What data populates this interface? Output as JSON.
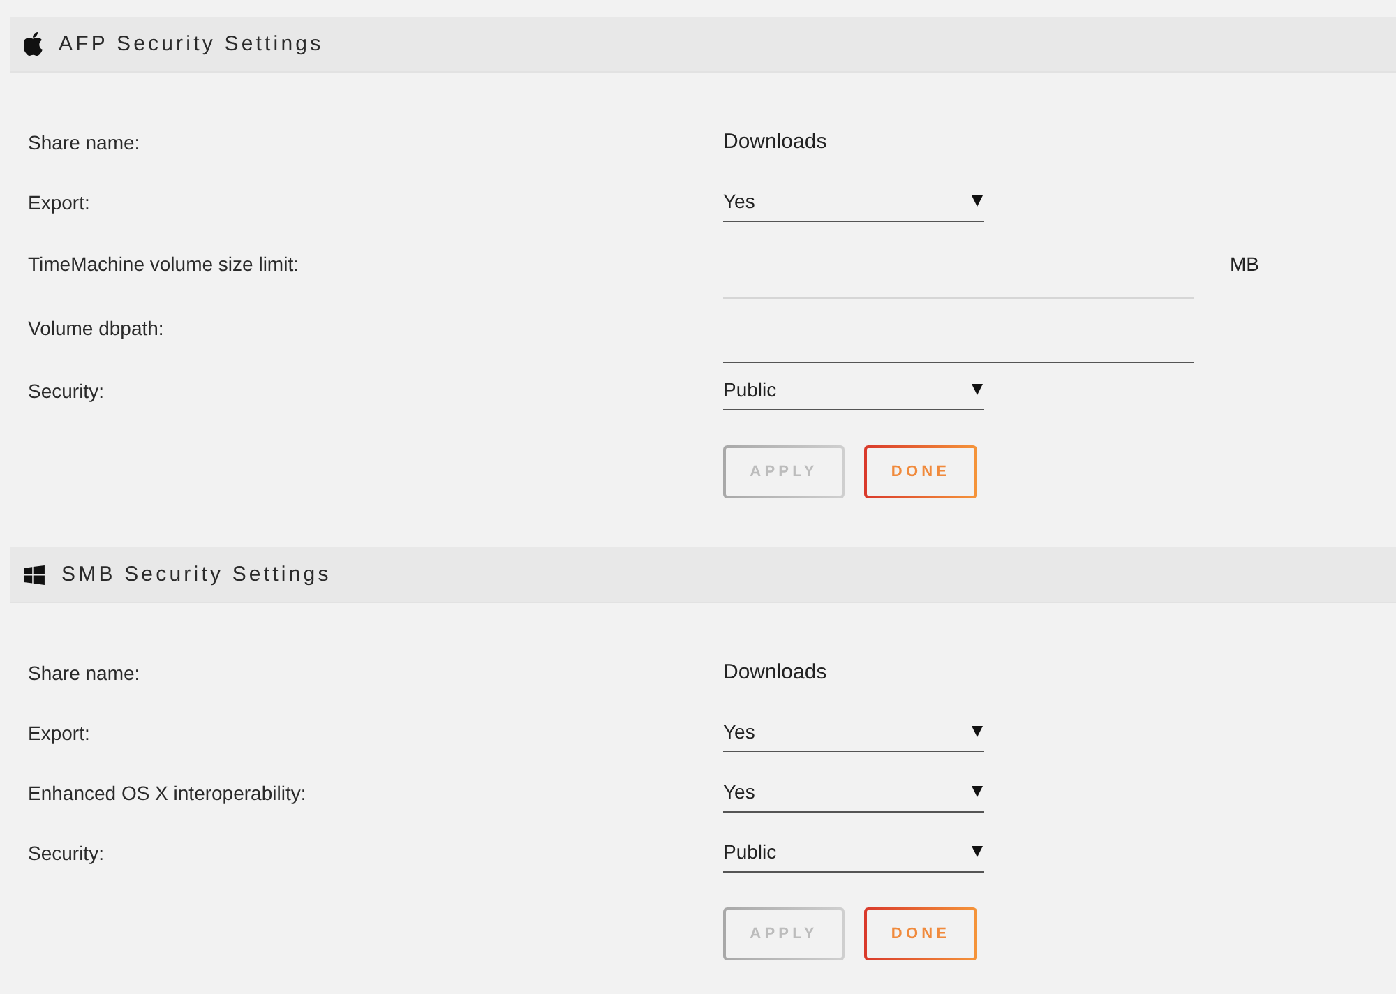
{
  "sections": [
    {
      "kind": "afp",
      "title": "AFP Security Settings",
      "fields": [
        {
          "kind": "text",
          "label": "Share name:",
          "value": "Downloads"
        },
        {
          "kind": "select",
          "label": "Export:",
          "value": "Yes"
        },
        {
          "kind": "input",
          "label": "TimeMachine volume size limit:",
          "disabled": true,
          "unit": "MB"
        },
        {
          "kind": "input",
          "label": "Volume dbpath:",
          "disabled": false
        },
        {
          "kind": "select",
          "label": "Security:",
          "value": "Public"
        }
      ],
      "buttons": [
        {
          "label": "APPLY",
          "disabled": true
        },
        {
          "label": "DONE",
          "disabled": false
        }
      ]
    },
    {
      "kind": "smb",
      "title": "SMB Security Settings",
      "fields": [
        {
          "kind": "text",
          "label": "Share name:",
          "value": "Downloads"
        },
        {
          "kind": "select",
          "label": "Export:",
          "value": "Yes"
        },
        {
          "kind": "select",
          "label": "Enhanced OS X interoperability:",
          "value": "Yes"
        },
        {
          "kind": "select",
          "label": "Security:",
          "value": "Public"
        }
      ],
      "buttons": [
        {
          "label": "APPLY",
          "disabled": true
        },
        {
          "label": "DONE",
          "disabled": false
        }
      ]
    }
  ]
}
